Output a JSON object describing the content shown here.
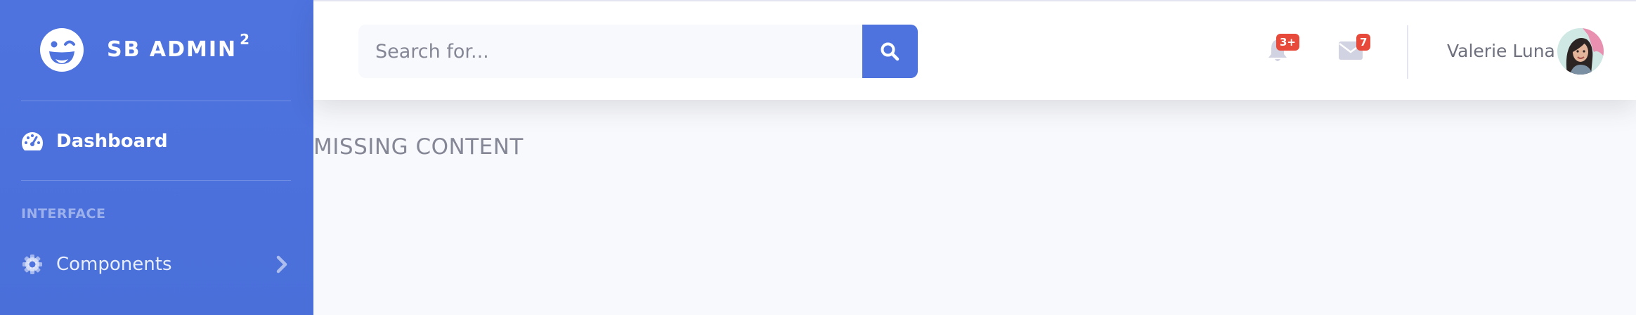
{
  "sidebar": {
    "brand": {
      "name": "SB ADMIN",
      "sup": "2",
      "logo_icon": "laugh-wink-icon"
    },
    "dashboard": {
      "label": "Dashboard",
      "icon": "tachometer-icon"
    },
    "heading": "INTERFACE",
    "components": {
      "label": "Components",
      "icon": "cog-icon",
      "chevron_icon": "chevron-right-icon"
    }
  },
  "topbar": {
    "search": {
      "placeholder": "Search for...",
      "button_icon": "search-icon"
    },
    "alerts": {
      "icon": "bell-icon",
      "badge": "3+"
    },
    "messages": {
      "icon": "envelope-icon",
      "badge": "7"
    },
    "user": {
      "name": "Valerie Luna"
    }
  },
  "main": {
    "text": "MISSING CONTENT"
  },
  "colors": {
    "primary": "#4e73df",
    "danger": "#e74a3b",
    "text_gray": "#858796",
    "background": "#f8f9fc"
  }
}
